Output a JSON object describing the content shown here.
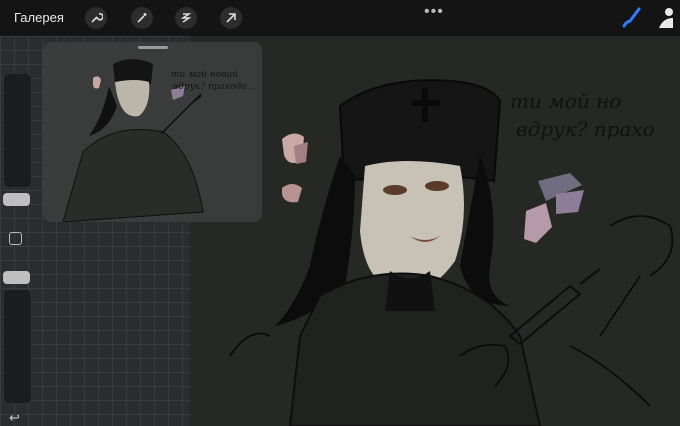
{
  "topbar": {
    "gallery_label": "Галерея",
    "tools": [
      "wrench-icon",
      "magic-wand-icon",
      "selection-icon",
      "transform-arrow-icon"
    ],
    "more_dots": "•••"
  },
  "canvas_text": {
    "line1": "ти мой но",
    "line2": "вдрук? прахо"
  },
  "reference_text": {
    "line1": "ти мой новий",
    "line2": "вдрук? прахода..."
  },
  "sidebar": {
    "undo_symbol": "↩"
  },
  "colors": {
    "accent_brush": "#2f7dff",
    "canvas_bg": "#262823",
    "toolbar_bg": "#141414"
  }
}
